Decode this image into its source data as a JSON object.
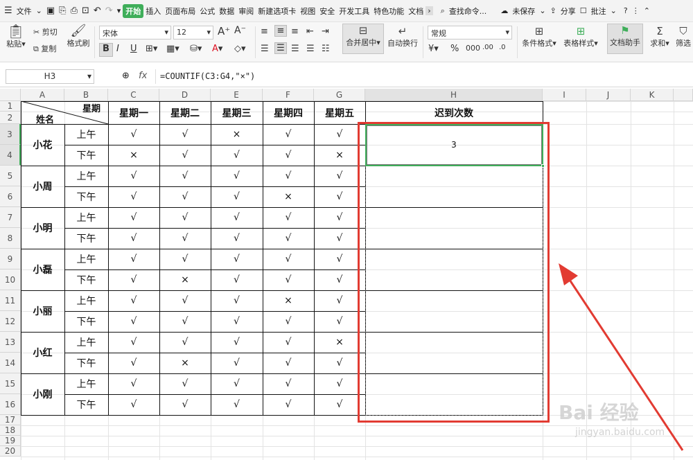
{
  "menubar": {
    "file": "文件",
    "tabs": [
      "开始",
      "插入",
      "页面布局",
      "公式",
      "数据",
      "审阅",
      "新建选项卡",
      "视图",
      "安全",
      "开发工具",
      "特色功能",
      "文档"
    ],
    "search": "查找命令...",
    "unsaved": "未保存",
    "share": "分享",
    "comment": "批注"
  },
  "ribbon": {
    "paste": "粘贴",
    "cut": "剪切",
    "copy": "复制",
    "format_painter": "格式刷",
    "font_name": "宋体",
    "font_size": "12",
    "merge_center": "合并居中",
    "wrap_text": "自动换行",
    "number_format": "常规",
    "cond_format": "条件格式",
    "table_style": "表格样式",
    "doc_assistant": "文档助手",
    "sum": "求和",
    "filter": "筛选"
  },
  "formula_bar": {
    "name_box": "H3",
    "fx": "fx",
    "formula": "=COUNTIF(C3:G4,\"×\")"
  },
  "columns": [
    "A",
    "B",
    "C",
    "D",
    "E",
    "F",
    "G",
    "H",
    "I",
    "J",
    "K"
  ],
  "rows": [
    "1",
    "2",
    "3",
    "4",
    "5",
    "6",
    "7",
    "8",
    "9",
    "10",
    "11",
    "12",
    "13",
    "14",
    "15",
    "16",
    "17",
    "18",
    "19",
    "20"
  ],
  "sheet": {
    "corner_top": "星期",
    "corner_bottom": "姓名",
    "days": [
      "星期一",
      "星期二",
      "星期三",
      "星期四",
      "星期五"
    ],
    "result_header": "迟到次数",
    "am": "上午",
    "pm": "下午",
    "names": [
      "小花",
      "小周",
      "小明",
      "小磊",
      "小丽",
      "小红",
      "小刚"
    ],
    "marks": [
      [
        "√",
        "√",
        "×",
        "√",
        "√"
      ],
      [
        "×",
        "√",
        "√",
        "√",
        "×"
      ],
      [
        "√",
        "√",
        "√",
        "√",
        "√"
      ],
      [
        "√",
        "√",
        "√",
        "×",
        "√"
      ],
      [
        "√",
        "√",
        "√",
        "√",
        "√"
      ],
      [
        "√",
        "√",
        "√",
        "√",
        "√"
      ],
      [
        "√",
        "√",
        "√",
        "√",
        "√"
      ],
      [
        "√",
        "×",
        "√",
        "√",
        "√"
      ],
      [
        "√",
        "√",
        "√",
        "×",
        "√"
      ],
      [
        "√",
        "√",
        "√",
        "√",
        "√"
      ],
      [
        "√",
        "√",
        "√",
        "√",
        "×"
      ],
      [
        "√",
        "×",
        "√",
        "√",
        "√"
      ],
      [
        "√",
        "√",
        "√",
        "√",
        "√"
      ],
      [
        "√",
        "√",
        "√",
        "√",
        "√"
      ]
    ],
    "result_value": "3"
  },
  "watermark": {
    "brand": "Bai 经验",
    "url": "jingyan.baidu.com"
  },
  "colors": {
    "accent": "#3fae5a",
    "annotation": "#e23b32"
  }
}
